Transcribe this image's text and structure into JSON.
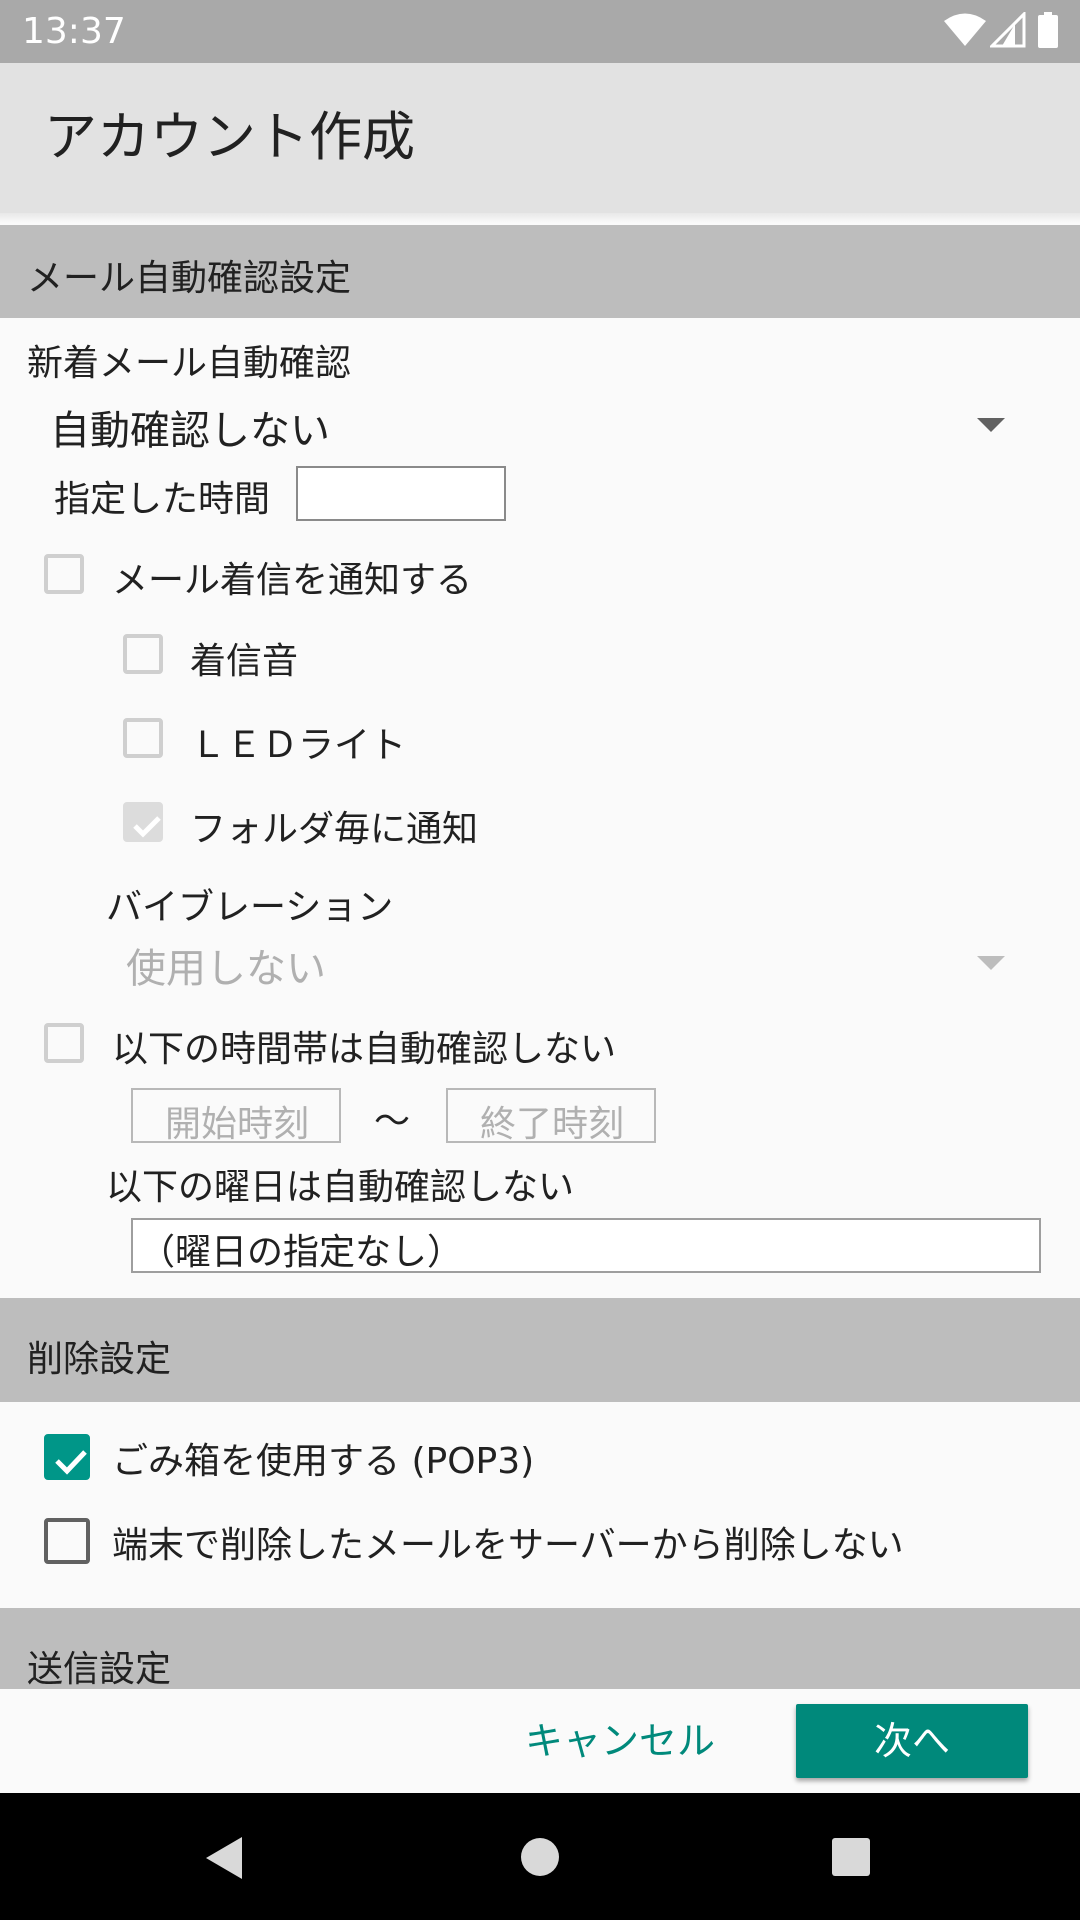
{
  "status_bar": {
    "time": "13:37",
    "icons": [
      "wifi-icon",
      "cell-signal-icon",
      "battery-icon"
    ]
  },
  "app_bar": {
    "title": "アカウント作成"
  },
  "auto_check_section": {
    "header": "メール自動確認設定",
    "new_mail_label": "新着メール自動確認",
    "interval_select": {
      "value": "自動確認しない"
    },
    "specified_time_label": "指定した時間",
    "specified_time_value": "",
    "notify_checkbox": {
      "label": "メール着信を通知する",
      "checked": false
    },
    "ringtone_checkbox": {
      "label": "着信音",
      "checked": false
    },
    "led_checkbox": {
      "label": "ＬＥＤライト",
      "checked": false
    },
    "per_folder_checkbox": {
      "label": "フォルダ毎に通知",
      "checked": true
    },
    "vibration_label": "バイブレーション",
    "vibration_select": {
      "value": "使用しない"
    },
    "exclude_time_checkbox": {
      "label": "以下の時間帯は自動確認しない",
      "checked": false
    },
    "start_time_placeholder": "開始時刻",
    "tilde": "～",
    "end_time_placeholder": "終了時刻",
    "exclude_days_label": "以下の曜日は自動確認しない",
    "days_value": "（曜日の指定なし）"
  },
  "delete_section": {
    "header": "削除設定",
    "trash_checkbox": {
      "label": "ごみ箱を使用する (POP3)",
      "checked": true
    },
    "keep_on_server_checkbox": {
      "label": "端末で削除したメールをサーバーから削除しない",
      "checked": false
    }
  },
  "send_section": {
    "header": "送信設定"
  },
  "buttons": {
    "cancel": "キャンセル",
    "next": "次へ"
  },
  "nav_bar": {
    "icons": [
      "back-icon",
      "home-icon",
      "recents-icon"
    ]
  },
  "colors": {
    "accent": "#00897b",
    "section_header_bg": "#bdbdbd",
    "status_bar_bg": "#a9a9a9"
  }
}
